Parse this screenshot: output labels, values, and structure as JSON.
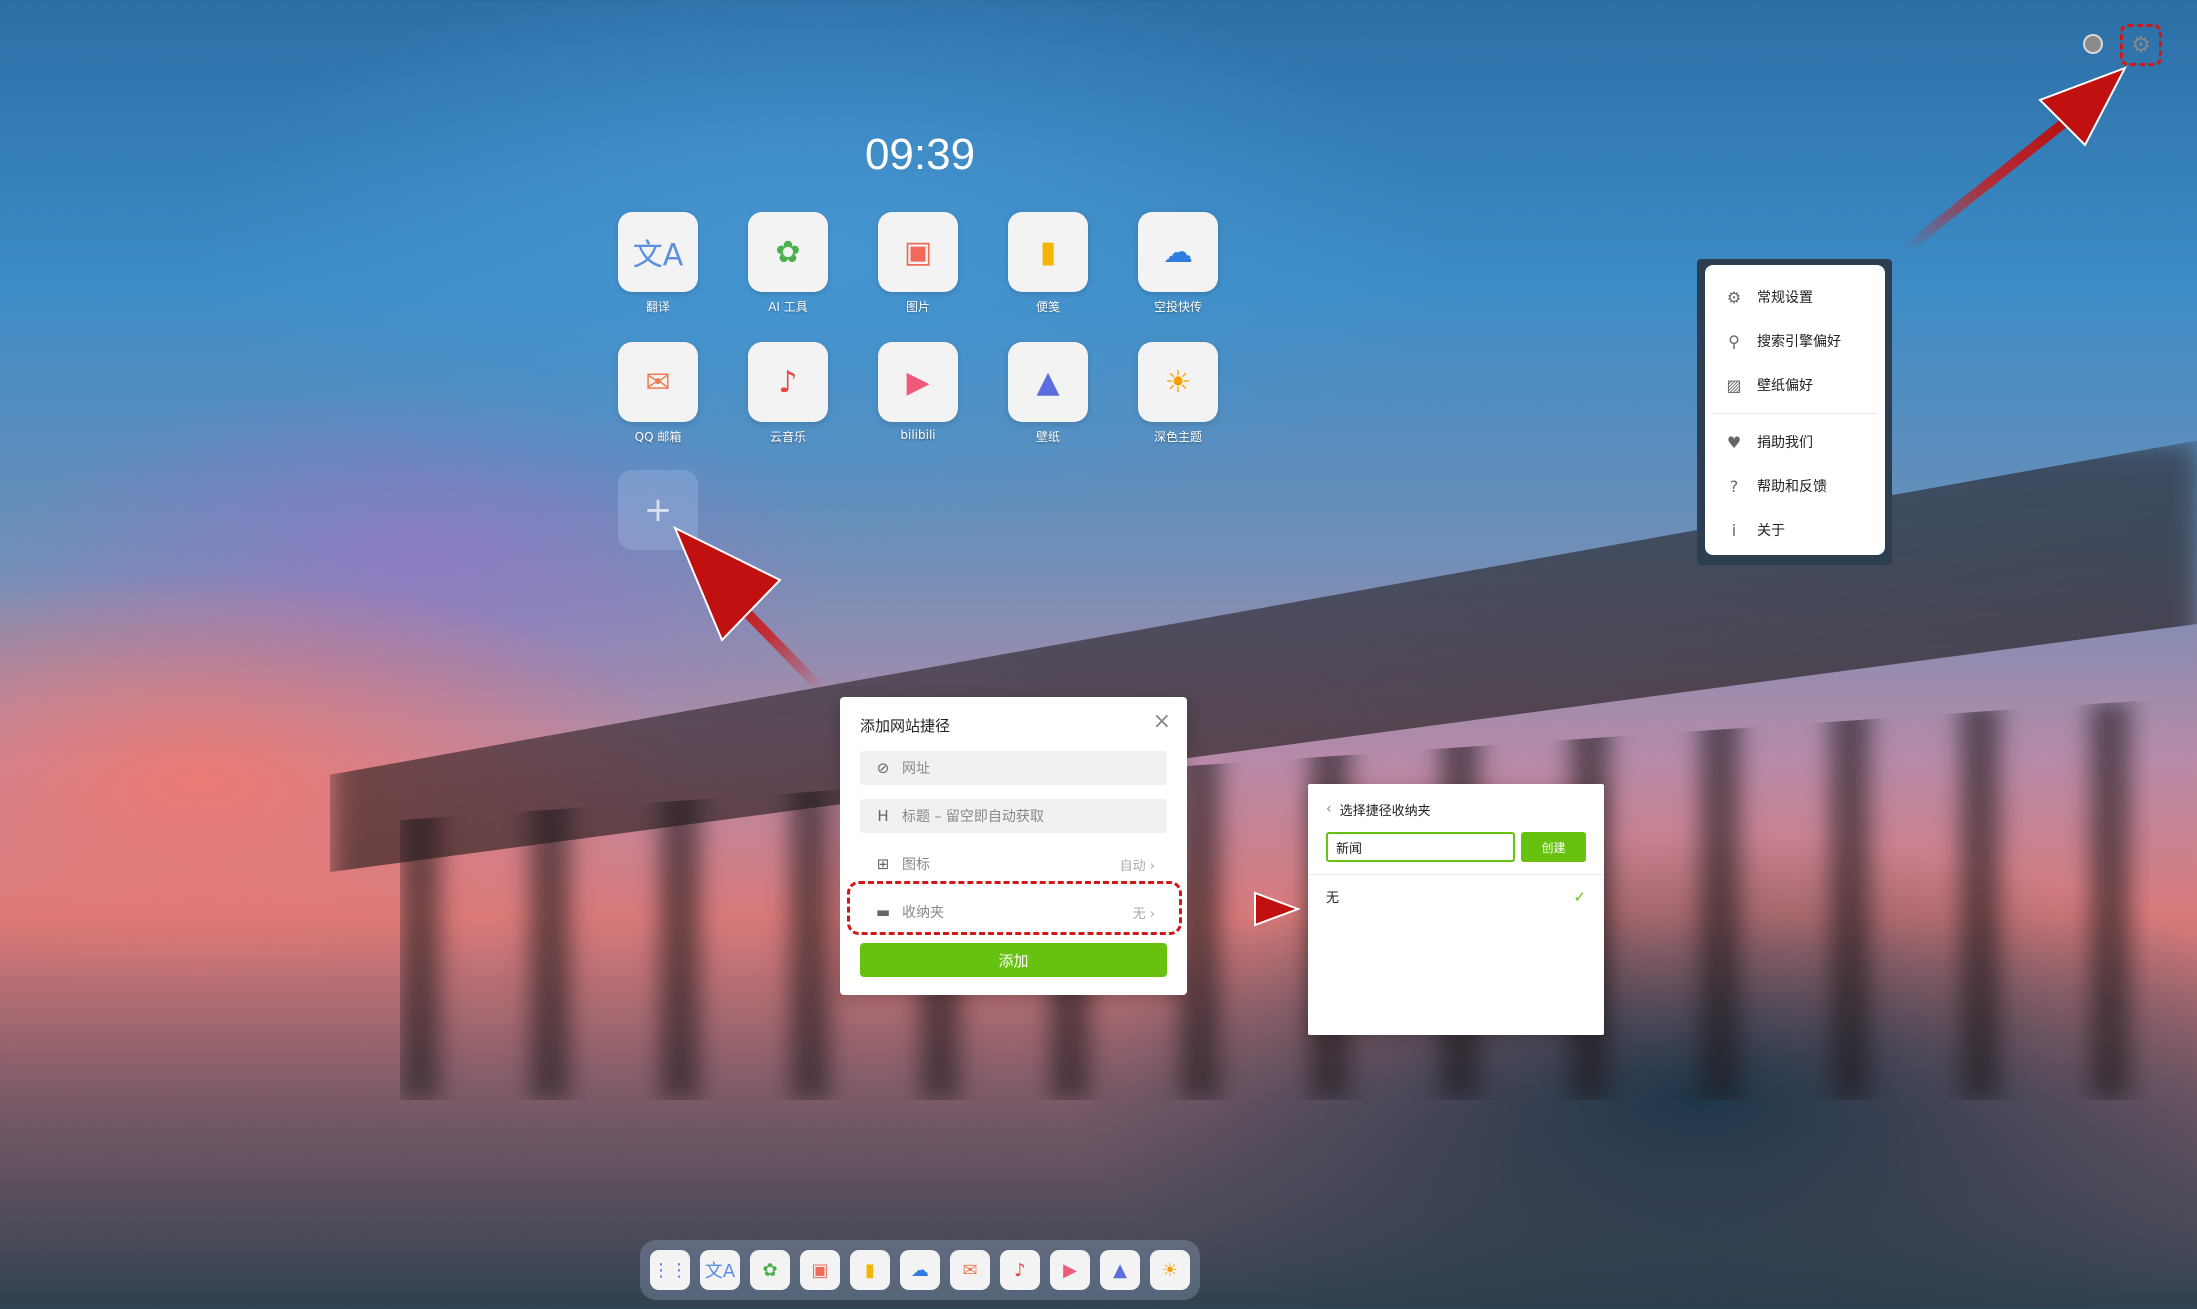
{
  "clock": "09:39",
  "tiles": [
    {
      "label": "翻译",
      "icon": "translate-icon",
      "glyph": "文A",
      "color": "#5a8fe0"
    },
    {
      "label": "AI 工具",
      "icon": "ai-tools-icon",
      "glyph": "✿",
      "color": "#4caf50"
    },
    {
      "label": "图片",
      "icon": "image-icon",
      "glyph": "▣",
      "color": "#f06a5a"
    },
    {
      "label": "便笺",
      "icon": "note-icon",
      "glyph": "▮",
      "color": "#f5b400"
    },
    {
      "label": "空投快传",
      "icon": "cloud-icon",
      "glyph": "☁",
      "color": "#2f7de0"
    },
    {
      "label": "QQ 邮箱",
      "icon": "mail-icon",
      "glyph": "✉",
      "color": "#f07a50"
    },
    {
      "label": "云音乐",
      "icon": "music-icon",
      "glyph": "♪",
      "color": "#e84545"
    },
    {
      "label": "bilibili",
      "icon": "video-icon",
      "glyph": "▶",
      "color": "#f05a7a"
    },
    {
      "label": "壁纸",
      "icon": "wallpaper-folder-icon",
      "glyph": "▲",
      "color": "#5a6ee0"
    },
    {
      "label": "深色主题",
      "icon": "sun-icon",
      "glyph": "☀",
      "color": "#f5a000"
    }
  ],
  "add_tile_glyph": "+",
  "settings_menu": [
    {
      "label": "常规设置",
      "glyph": "⚙",
      "icon": "gear-icon"
    },
    {
      "label": "搜索引擎偏好",
      "glyph": "⚲",
      "icon": "search-icon"
    },
    {
      "label": "壁纸偏好",
      "glyph": "▨",
      "icon": "wallpaper-icon"
    },
    {
      "label": "捐助我们",
      "glyph": "♥",
      "icon": "heart-icon"
    },
    {
      "label": "帮助和反馈",
      "glyph": "?",
      "icon": "help-icon"
    },
    {
      "label": "关于",
      "glyph": "i",
      "icon": "info-icon"
    }
  ],
  "dialog": {
    "title": "添加网站捷径",
    "close": "×",
    "url_placeholder": "网址",
    "title_placeholder": "标题 – 留空即自动获取",
    "icon_label": "图标",
    "icon_value": "自动",
    "folder_label": "收纳夹",
    "folder_value": "无",
    "submit": "添加",
    "chevron": "›",
    "url_glyph": "⊘",
    "title_glyph": "H",
    "icon_glyph": "⊞",
    "folder_glyph": "▬"
  },
  "folder_panel": {
    "back": "‹",
    "title": "选择捷径收纳夹",
    "input_value": "新闻",
    "create": "创建",
    "option": "无",
    "check": "✓"
  },
  "top_bar": {
    "gear_glyph": "⚙"
  },
  "dock": [
    {
      "glyph": "⋮⋮",
      "icon": "apps-grid-icon",
      "color": "#5a7ae0"
    },
    {
      "glyph": "文A",
      "icon": "translate-icon",
      "color": "#5a8fe0"
    },
    {
      "glyph": "✿",
      "icon": "ai-tools-icon",
      "color": "#4caf50"
    },
    {
      "glyph": "▣",
      "icon": "image-icon",
      "color": "#f06a5a"
    },
    {
      "glyph": "▮",
      "icon": "note-icon",
      "color": "#f5b400"
    },
    {
      "glyph": "☁",
      "icon": "cloud-icon",
      "color": "#2f7de0"
    },
    {
      "glyph": "✉",
      "icon": "mail-icon",
      "color": "#f07a50"
    },
    {
      "glyph": "♪",
      "icon": "music-icon",
      "color": "#e84545"
    },
    {
      "glyph": "▶",
      "icon": "video-icon",
      "color": "#f05a7a"
    },
    {
      "glyph": "▲",
      "icon": "wallpaper-folder-icon",
      "color": "#5a6ee0"
    },
    {
      "glyph": "☀",
      "icon": "sun-icon",
      "color": "#f5a000"
    }
  ],
  "colors": {
    "accent_green": "#66c20e",
    "annotation_red": "#d01818"
  }
}
